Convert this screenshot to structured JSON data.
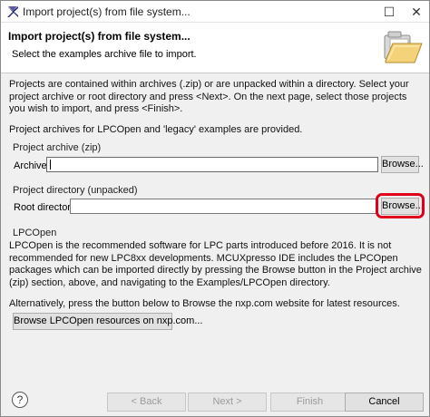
{
  "window": {
    "title": "Import project(s) from file system...",
    "maximize_glyph": "☐",
    "close_glyph": "✕"
  },
  "banner": {
    "title": "Import project(s) from file system...",
    "description": "Select the examples archive file to import."
  },
  "intro": {
    "text": "Projects are contained within archives (.zip) or are unpacked within a directory. Select your project archive or root directory and press <Next>. On the next page, select those projects you wish to import, and press <Finish>.",
    "note": "Project archives for LPCOpen and 'legacy' examples are provided."
  },
  "archive_group": {
    "label": "Project archive (zip)",
    "field_label": "Archive",
    "value": "",
    "browse_label": "Browse..."
  },
  "directory_group": {
    "label": "Project directory (unpacked)",
    "field_label": "Root directory",
    "value": "",
    "browse_label": "Browse..."
  },
  "lpcopen_group": {
    "label": "LPCOpen",
    "text": "LPCOpen is the recommended software for LPC parts introduced before 2016. It is not recommended for new LPC8xx developments. MCUXpresso IDE includes the LPCOpen packages which can be imported directly by pressing the Browse button in the Project archive (zip) section, above, and navigating to the Examples/LPCOpen directory.",
    "alt_text": "Alternatively, press the button below to Browse the nxp.com website for latest resources.",
    "button_label": "Browse LPCOpen resources on nxp.com..."
  },
  "footer": {
    "help_glyph": "?",
    "back_label": "< Back",
    "next_label": "Next >",
    "finish_label": "Finish",
    "cancel_label": "Cancel"
  },
  "colors": {
    "highlight": "#e0001b",
    "app_icon": "#2a2a6e"
  }
}
